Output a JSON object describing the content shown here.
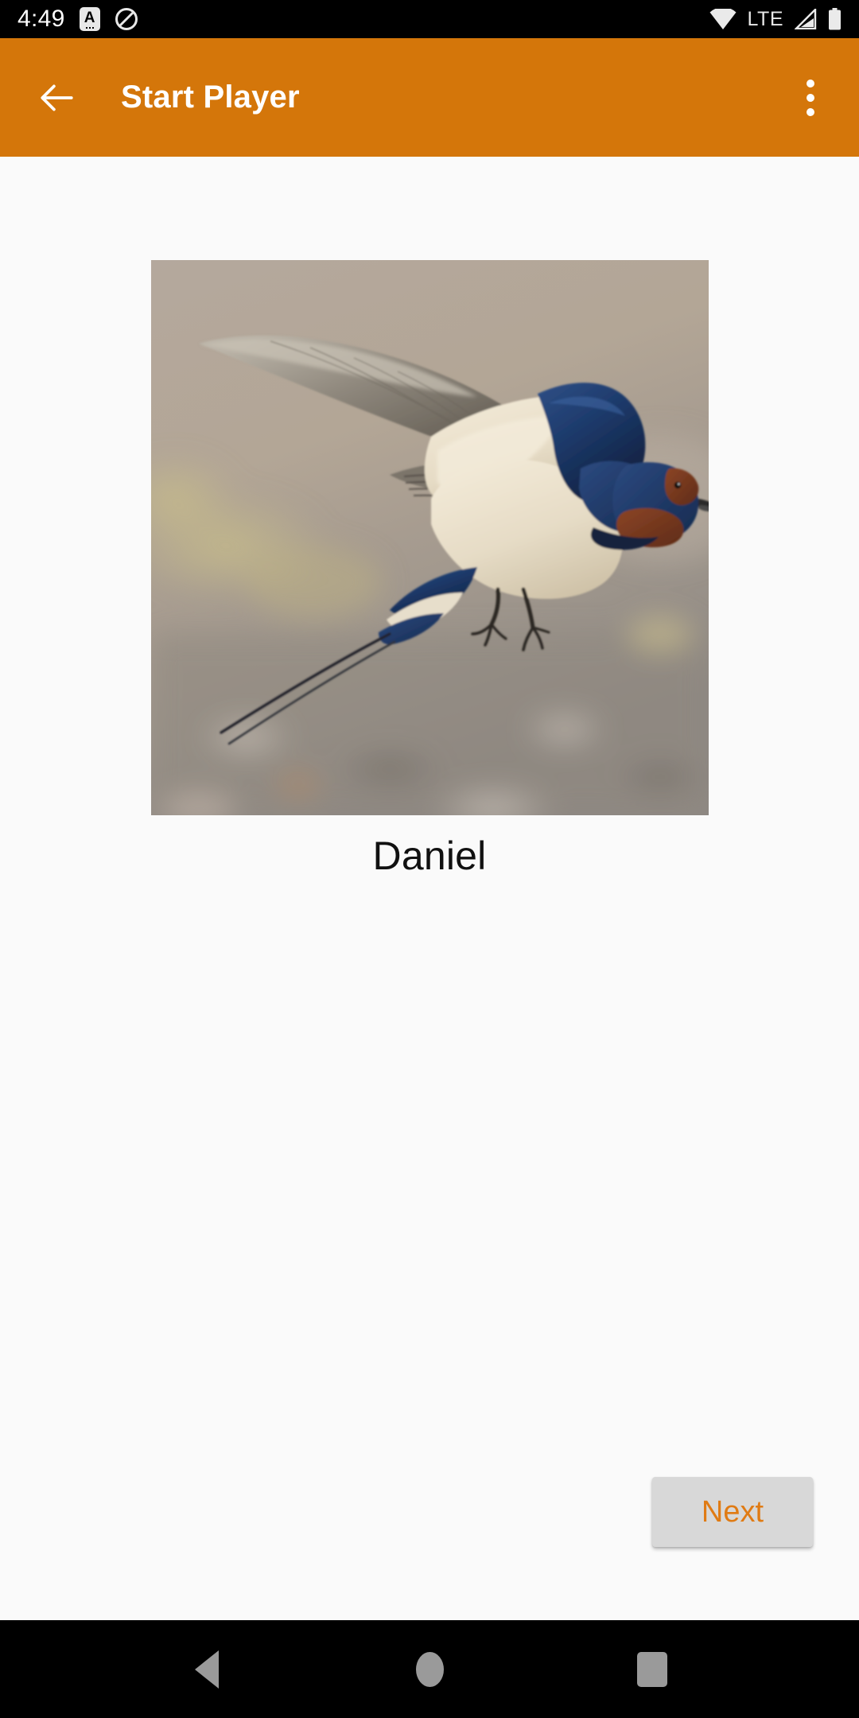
{
  "status_bar": {
    "time": "4:49",
    "network_type": "LTE",
    "icons": [
      {
        "name": "alarm-badge-icon",
        "glyph": "A"
      },
      {
        "name": "do-not-disturb-icon",
        "glyph": "⊘"
      },
      {
        "name": "wifi-icon",
        "glyph": "▼"
      },
      {
        "name": "signal-icon",
        "glyph": "◢"
      },
      {
        "name": "battery-icon",
        "glyph": "▮"
      }
    ],
    "background_color": "#000000",
    "foreground_color": "#ffffff"
  },
  "app_bar": {
    "title": "Start Player",
    "back_label": "←",
    "overflow_label": "⋮",
    "background_color": "#d4760a",
    "text_color": "#ffffff"
  },
  "main": {
    "player": {
      "name": "Daniel",
      "photo_alt": "barn-swallow-in-flight",
      "photo_width": 701,
      "photo_height": 698
    },
    "background_color": "#fafafa",
    "name_color": "#111111"
  },
  "actions": {
    "next_label": "Next",
    "next_text_color": "#e07b14",
    "next_background_color": "#d8d8d8"
  },
  "nav_bar": {
    "back_label": "Back",
    "home_label": "Home",
    "recents_label": "Recents",
    "background_color": "#000000",
    "icon_color": "#9a9a9a"
  }
}
